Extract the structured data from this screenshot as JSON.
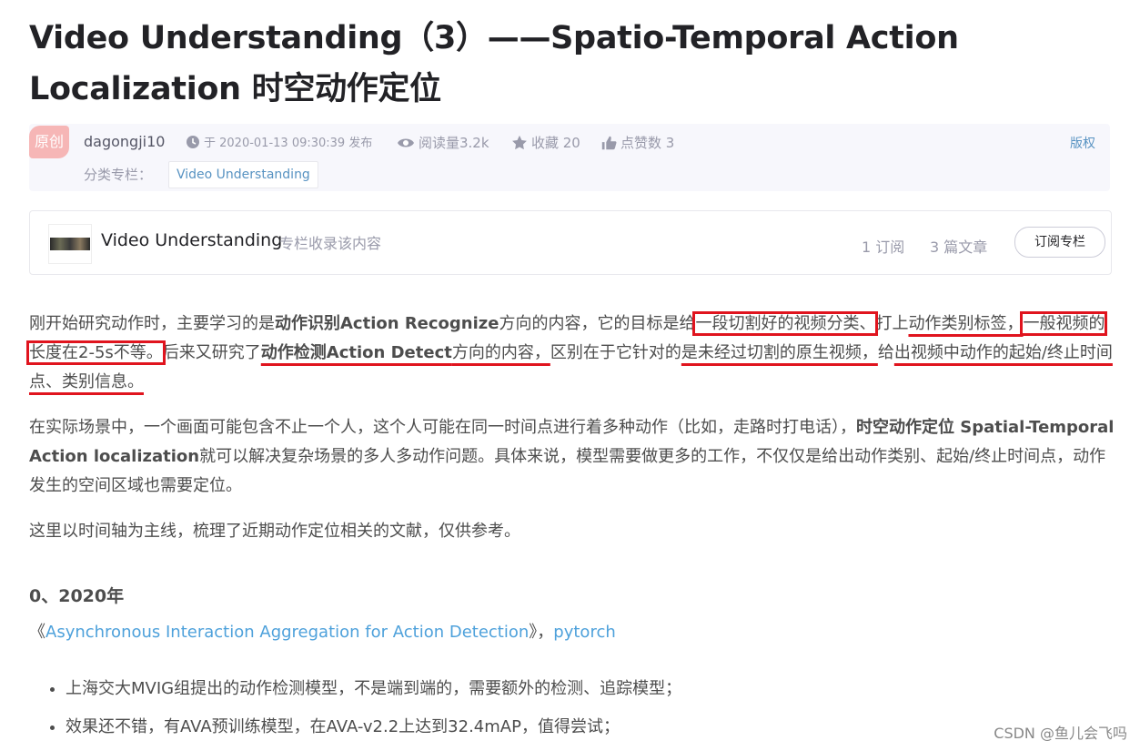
{
  "article": {
    "title": "Video Understanding（3）——Spatio-Temporal Action Localization 时空动作定位",
    "badge": "原创",
    "author": "dagongji10",
    "date": "于 2020-01-13 09:30:39 发布",
    "views": "阅读量3.2k",
    "favorites": "收藏 20",
    "likes": "点赞数 3",
    "copyright": "版权",
    "category_label": "分类专栏：",
    "category_tag": "Video Understanding"
  },
  "column": {
    "name": "Video Understanding",
    "hint": "专栏收录该内容",
    "subscribers": "1 订阅",
    "articles": "3 篇文章",
    "subscribe_button": "订阅专栏"
  },
  "body": {
    "p1": {
      "s1": "刚开始研究动作时，主要学习的是",
      "b1": "动作识别Action Recognize",
      "s2": "方向的内容，它的目标是给",
      "box1": "一段切割好的视频分类、",
      "s3": "打上",
      "ul1": "动作类别标签，",
      "box2": "一般视频的长度在2-5s不等。",
      "s4": "后来又研究了",
      "b2": "动作检测Action Detect",
      "ul2": "方向的内容，",
      "s5": "区别在于它针对的",
      "ul3": "是未经过切割的原生视频，",
      "s6": "给",
      "ul4": "出视频中动作的起始/终止时间点、类别信息。"
    },
    "p2": {
      "s1": "在实际场景中，一个画面可能包含不止一个人，这个人可能在同一时间点进行着多种动作（比如，走路时打电话），",
      "b1": "时空动作定位 Spatial-Temporal Action localization",
      "s2": "就可以解决复杂场景的多人多动作问题。具体来说，模型需要做更多的工作，不仅仅是给出动作类别、起始/终止时间点，动作发生的空间区域也需要定位。"
    },
    "p3": "这里以时间轴为主线，梳理了近期动作定位相关的文献，仅供参考。",
    "section_heading": "0、2020年",
    "ref_open": "《",
    "ref_title": "Asynchronous Interaction Aggregation for Action Detection",
    "ref_close": "》，",
    "ref_code": "pytorch",
    "bullets": [
      "上海交大MVIG组提出的动作检测模型，不是端到端的，需要额外的检测、追踪模型；",
      "效果还不错，有AVA预训练模型，在AVA-v2.2上达到32.4mAP，值得尝试；"
    ]
  },
  "watermark": "CSDN @鱼儿会飞吗",
  "colors": {
    "annotation_red": "#e0141e",
    "link_blue": "#4ea1db",
    "badge_pink": "#f6b6b6"
  }
}
